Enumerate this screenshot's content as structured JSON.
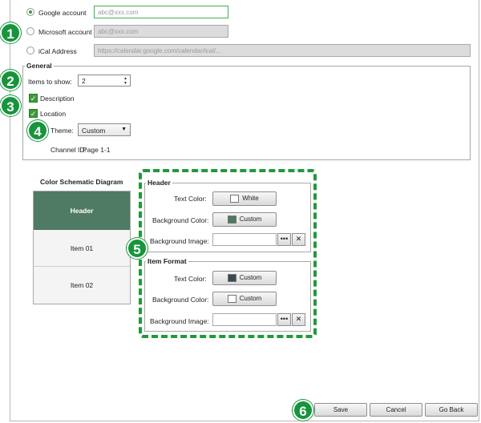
{
  "accounts": {
    "google_label": "Google account",
    "google_placeholder": "abc@xxx.com",
    "microsoft_label": "Microsoft account",
    "microsoft_placeholder": "abc@xxx.com",
    "ical_label": "iCal Address",
    "ical_placeholder": "https://calendar.google.com/calendar/ical/..."
  },
  "general": {
    "title": "General",
    "items_to_show_label": "Items to show:",
    "items_to_show_value": "2",
    "description_label": "Description",
    "location_label": "Location",
    "theme_label": "Theme:",
    "theme_value": "Custom",
    "channel_id_label": "Channel ID:",
    "channel_id_value": "Page 1-1"
  },
  "diagram": {
    "title": "Color Schematic Diagram",
    "header": "Header",
    "item1": "Item 01",
    "item2": "Item 02"
  },
  "header_section": {
    "title": "Header",
    "text_color_label": "Text Color:",
    "text_color_value": "White",
    "bg_color_label": "Background Color:",
    "bg_color_value": "Custom",
    "bg_image_label": "Background Image:"
  },
  "item_format": {
    "title": "Item Format",
    "text_color_label": "Text Color:",
    "text_color_value": "Custom",
    "bg_color_label": "Background Color:",
    "bg_color_value": "Custom",
    "bg_image_label": "Background Image:"
  },
  "badges": {
    "b1": "1",
    "b2": "2",
    "b3": "3",
    "b4": "4",
    "b5": "5",
    "b6": "6"
  },
  "footer": {
    "save": "Save",
    "cancel": "Cancel",
    "go_back": "Go Back"
  },
  "icons": {
    "browse": "ellipsis-icon",
    "clear": "close-icon"
  },
  "colors": {
    "accent_green": "#17953c",
    "diagram_header_bg": "#4f7a63",
    "item_text_swatch": "#3d4a52",
    "header_bg_swatch": "#4f7a63"
  }
}
